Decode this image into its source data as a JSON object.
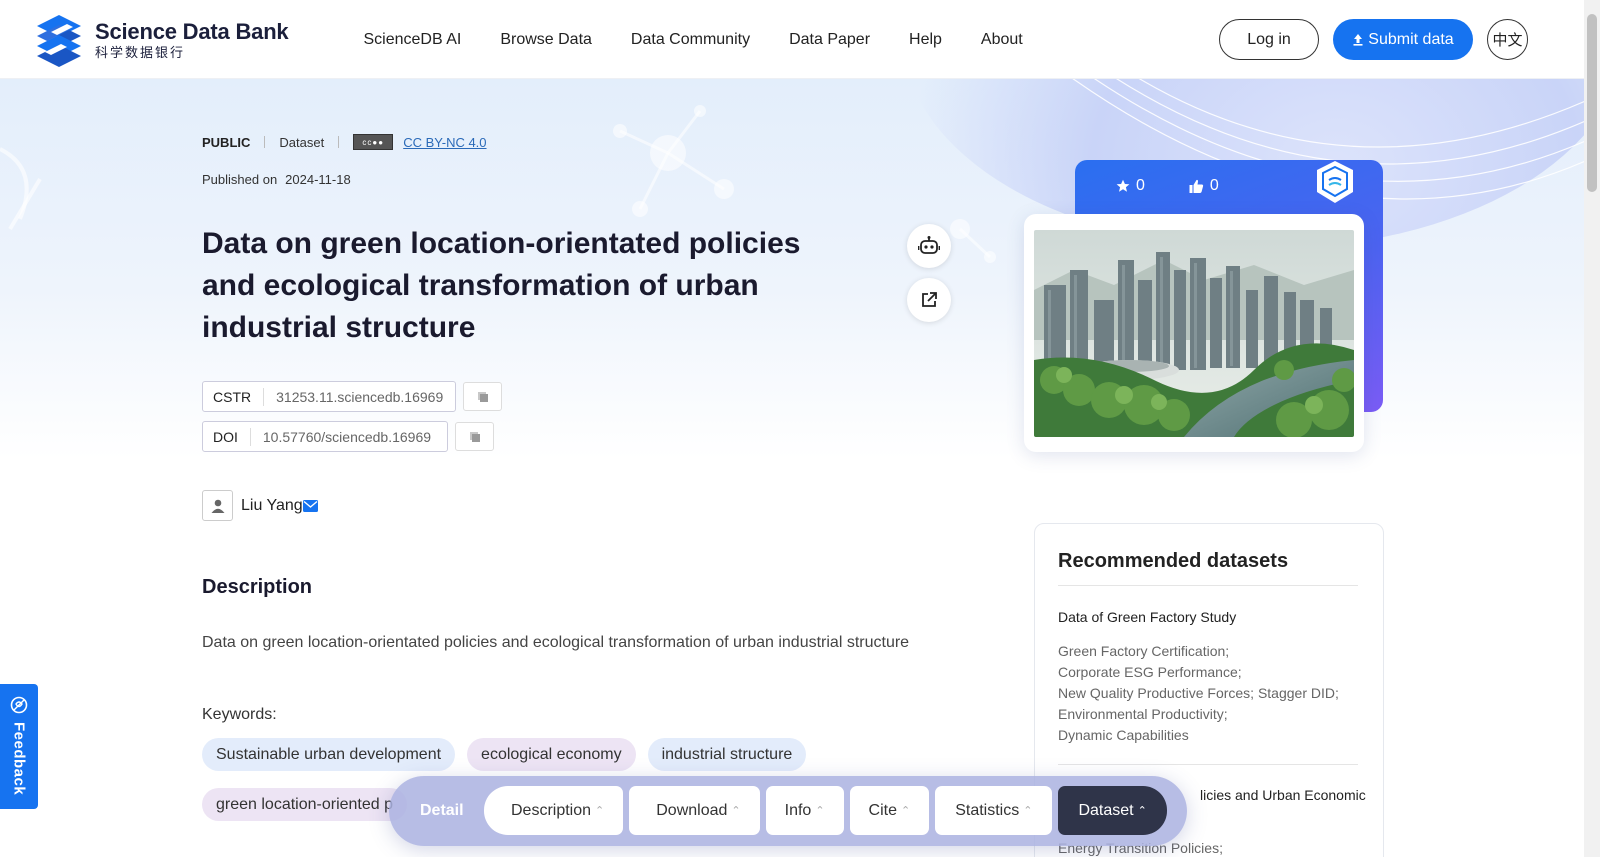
{
  "brand": {
    "name_en": "Science Data Bank",
    "name_cn": "科学数据银行"
  },
  "nav": [
    "ScienceDB AI",
    "Browse Data",
    "Data Community",
    "Data Paper",
    "Help",
    "About"
  ],
  "header": {
    "login": "Log in",
    "submit": "Submit data",
    "lang": "中文"
  },
  "meta": {
    "visibility": "PUBLIC",
    "type": "Dataset",
    "license": "CC BY-NC 4.0",
    "published_label": "Published on",
    "published_date": "2024-11-18"
  },
  "title": "Data on green location-orientated policies and ecological transformation of urban industrial structure",
  "identifiers": {
    "cstr_label": "CSTR",
    "cstr_value": "31253.11.sciencedb.16969",
    "doi_label": "DOI",
    "doi_value": "10.57760/sciencedb.16969"
  },
  "author": {
    "name": "Liu Yang"
  },
  "description": {
    "heading": "Description",
    "text": "Data on green location-orientated policies and ecological transformation of urban industrial structure",
    "keywords_label": "Keywords:",
    "keywords": [
      "Sustainable urban development",
      "ecological economy",
      "industrial structure",
      "green location-oriented p"
    ]
  },
  "card": {
    "stars": "0",
    "likes": "0"
  },
  "recommended": {
    "heading": "Recommended datasets",
    "item1_title": "Data of Green Factory Study",
    "item1_keywords": [
      "Green Factory Certification;",
      "Corporate ESG Performance;",
      "New Quality Productive Forces; Stagger DID;",
      "Environmental Productivity;",
      "Dynamic Capabilities"
    ],
    "item2_title": "licies and Urban Economic",
    "item2_keyword": "Energy Transition Policies;"
  },
  "feedback": "Feedback",
  "floatbar": {
    "label": "Detail",
    "tabs": [
      "Description",
      "Download",
      "Info",
      "Cite",
      "Statistics",
      "Dataset"
    ]
  },
  "colors": {
    "primary": "#1673f0",
    "dark_tab": "#2f3449",
    "title": "#1a1a2e"
  }
}
